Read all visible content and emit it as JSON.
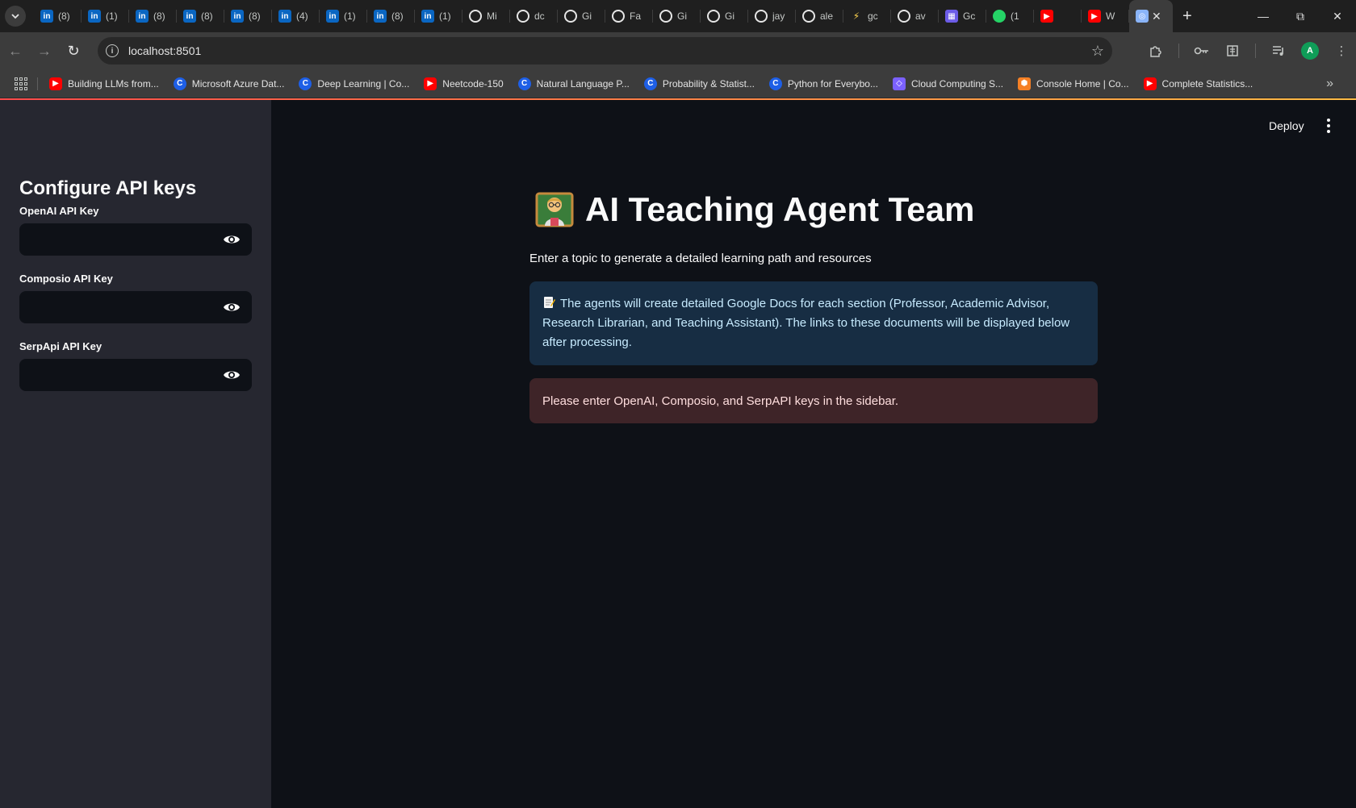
{
  "browser": {
    "tabs": [
      {
        "icon": "linkedin-icon",
        "title": "(8)"
      },
      {
        "icon": "linkedin-icon",
        "title": "(1)"
      },
      {
        "icon": "linkedin-icon",
        "title": "(8)"
      },
      {
        "icon": "linkedin-icon",
        "title": "(8)"
      },
      {
        "icon": "linkedin-icon",
        "title": "(8)"
      },
      {
        "icon": "linkedin-icon",
        "title": "(4)"
      },
      {
        "icon": "linkedin-icon",
        "title": "(1)"
      },
      {
        "icon": "linkedin-icon",
        "title": "(8)"
      },
      {
        "icon": "linkedin-icon",
        "title": "(1)"
      },
      {
        "icon": "github-icon",
        "title": "Mi"
      },
      {
        "icon": "github-icon",
        "title": "dc"
      },
      {
        "icon": "github-icon",
        "title": "Gi"
      },
      {
        "icon": "github-icon",
        "title": "Fa"
      },
      {
        "icon": "github-icon",
        "title": "Gi"
      },
      {
        "icon": "github-icon",
        "title": "Gi"
      },
      {
        "icon": "github-icon",
        "title": "jay"
      },
      {
        "icon": "github-icon",
        "title": "ale"
      },
      {
        "icon": "bolt-icon",
        "title": "gc"
      },
      {
        "icon": "github-icon",
        "title": "av"
      },
      {
        "icon": "grid-app-icon",
        "title": "Gc"
      },
      {
        "icon": "whatsapp-icon",
        "title": "(1"
      },
      {
        "icon": "youtube-icon",
        "title": ""
      },
      {
        "icon": "youtube-icon",
        "title": "W"
      }
    ],
    "active_tab_icon": "robot-icon",
    "url": "localhost:8501",
    "profile_initial": "A",
    "bookmarks": [
      {
        "icon": "youtube-icon",
        "label": "Building LLMs from..."
      },
      {
        "icon": "coursera-icon",
        "label": "Microsoft Azure Dat..."
      },
      {
        "icon": "coursera-icon",
        "label": "Deep Learning | Co..."
      },
      {
        "icon": "youtube-icon",
        "label": "Neetcode-150"
      },
      {
        "icon": "coursera-icon",
        "label": "Natural Language P..."
      },
      {
        "icon": "coursera-icon",
        "label": "Probability & Statist..."
      },
      {
        "icon": "coursera-icon",
        "label": "Python for Everybo..."
      },
      {
        "icon": "cloud-icon",
        "label": "Cloud Computing S..."
      },
      {
        "icon": "aws-icon",
        "label": "Console Home | Co..."
      },
      {
        "icon": "youtube-icon",
        "label": "Complete Statistics..."
      }
    ]
  },
  "sidebar": {
    "title": "Configure API keys",
    "fields": [
      {
        "label": "OpenAI API Key",
        "value": ""
      },
      {
        "label": "Composio API Key",
        "value": ""
      },
      {
        "label": "SerpApi API Key",
        "value": ""
      }
    ]
  },
  "header": {
    "deploy_label": "Deploy"
  },
  "main": {
    "title": "AI Teaching Agent Team",
    "subtitle": "Enter a topic to generate a detailed learning path and resources",
    "info": "The agents will create detailed Google Docs for each section (Professor, Academic Advisor, Research Librarian, and Teaching Assistant). The links to these documents will be displayed below after processing.",
    "error": "Please enter OpenAI, Composio, and SerpAPI keys in the sidebar."
  },
  "colors": {
    "accent_gradient_start": "#ff4b4b",
    "accent_gradient_end": "#ffbd45",
    "info_bg": "#172d43",
    "error_bg": "#3e2428"
  }
}
